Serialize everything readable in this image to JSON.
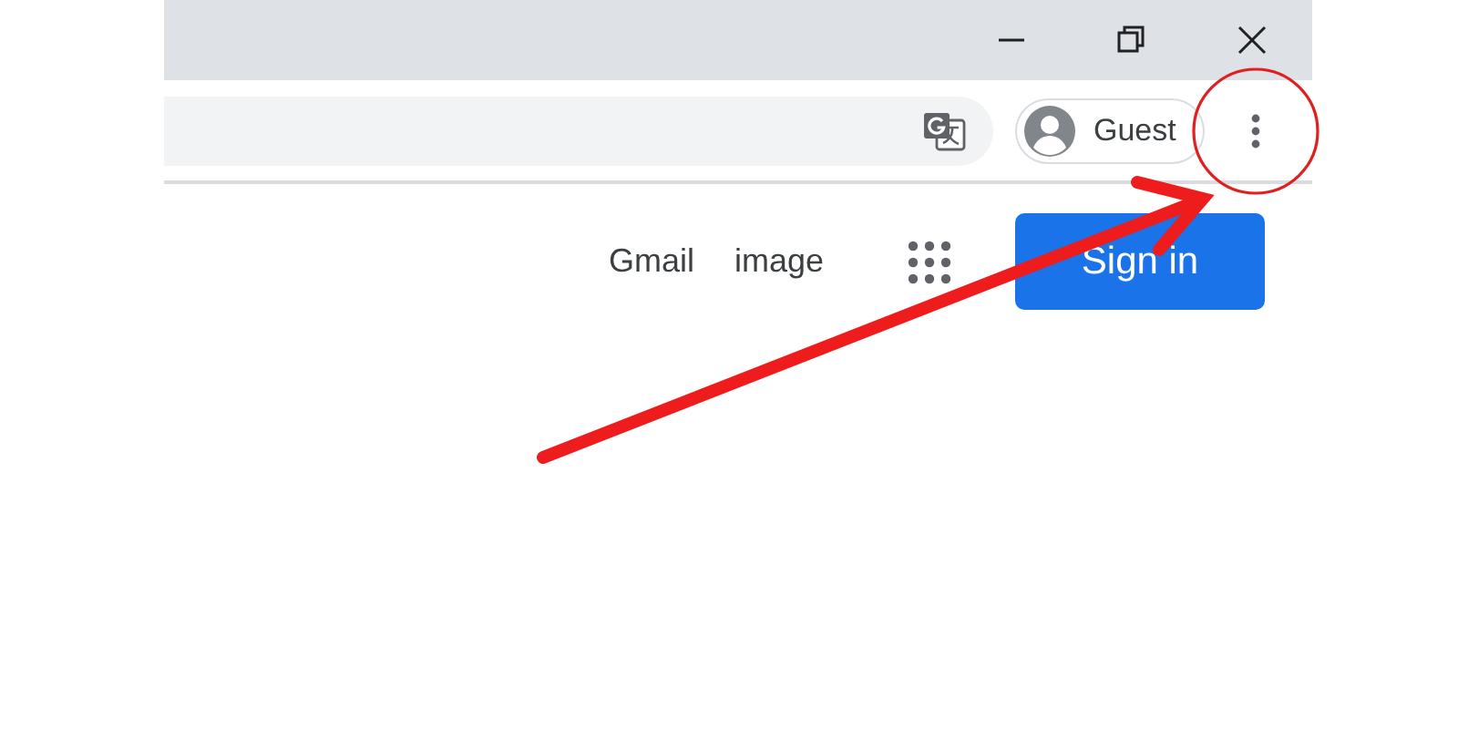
{
  "title_bar": {
    "controls": [
      {
        "kind": "minimize"
      },
      {
        "kind": "restore"
      },
      {
        "kind": "close"
      }
    ]
  },
  "toolbar": {
    "profile": {
      "label": "Guest"
    }
  },
  "header": {
    "links": [
      "Gmail",
      "image"
    ],
    "sign_in": "Sign in"
  }
}
